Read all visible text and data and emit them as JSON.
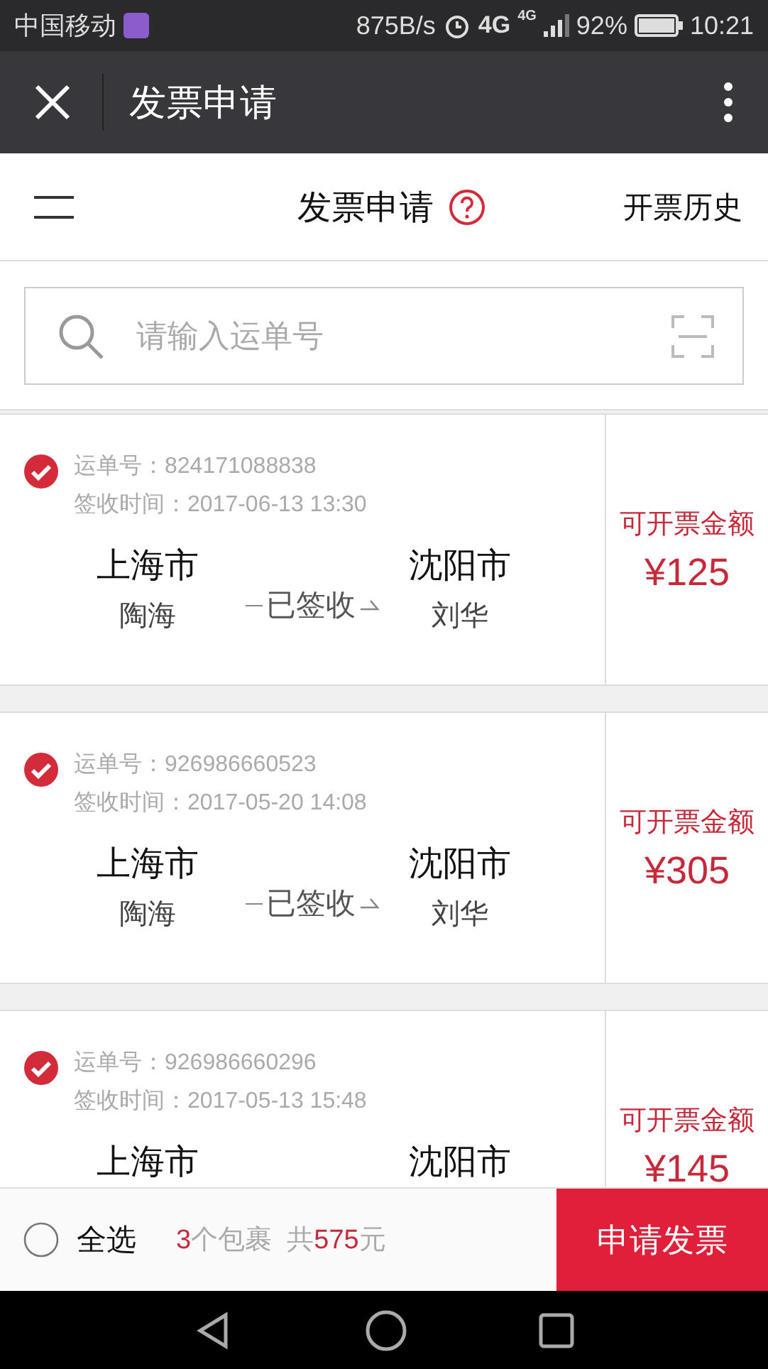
{
  "status_bar": {
    "carrier": "中国移动",
    "speed": "875B/s",
    "network": "4G",
    "network_2": "4G",
    "battery": "92%",
    "time": "10:21"
  },
  "app_bar": {
    "title": "发票申请"
  },
  "header": {
    "title": "发票申请",
    "history": "开票历史"
  },
  "search": {
    "placeholder": "请输入运单号"
  },
  "orders": [
    {
      "checked": true,
      "waybill_label": "运单号：",
      "waybill": "824171088838",
      "time_label": "签收时间：",
      "time": "2017-06-13 13:30",
      "from_city": "上海市",
      "from_person": "陶海",
      "status": "已签收",
      "to_city": "沈阳市",
      "to_person": "刘华",
      "amount_label": "可开票金额",
      "amount": "¥125"
    },
    {
      "checked": true,
      "waybill_label": "运单号：",
      "waybill": "926986660523",
      "time_label": "签收时间：",
      "time": "2017-05-20 14:08",
      "from_city": "上海市",
      "from_person": "陶海",
      "status": "已签收",
      "to_city": "沈阳市",
      "to_person": "刘华",
      "amount_label": "可开票金额",
      "amount": "¥305"
    },
    {
      "checked": true,
      "waybill_label": "运单号：",
      "waybill": "926986660296",
      "time_label": "签收时间：",
      "time": "2017-05-13 15:48",
      "from_city": "上海市",
      "to_city": "沈阳市",
      "amount_label": "可开票金额",
      "amount": "¥145"
    }
  ],
  "footer": {
    "select_all": {
      "label": "全选",
      "checked": false
    },
    "count": "3",
    "count_unit": "个包裹",
    "total_prefix": "共",
    "total": "575",
    "total_unit": "元",
    "submit": "申请发票"
  }
}
